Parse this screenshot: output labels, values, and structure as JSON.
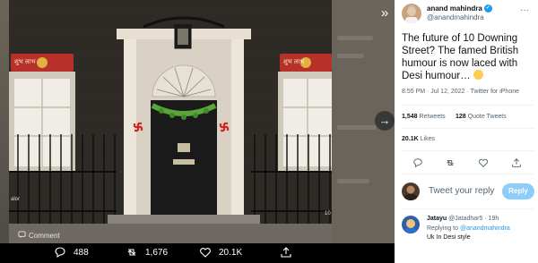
{
  "viewer": {
    "photo_texts": {
      "sign_left": "शुभ  लाभ",
      "sign_right": "शुभ  लाभ",
      "caption_left": "alor",
      "caption_right": "10"
    },
    "comment_label": "Comment",
    "actions": {
      "reply_count": "488",
      "retweet_count": "1,676",
      "like_count": "20.1K"
    },
    "bleed_text": "You a"
  },
  "tweet": {
    "author_name": "anand mahindra",
    "author_handle": "@anandmahindra",
    "text": "The future of 10 Downing Street?  The famed British humour is now laced with Desi humour…",
    "meta": "8:55 PM · Jul 12, 2022 · Twitter for iPhone",
    "retweets": "1,548",
    "retweets_label": "Retweets",
    "quotes": "128",
    "quotes_label": "Quote Tweets",
    "likes": "20.1K",
    "likes_label": "Likes"
  },
  "compose": {
    "placeholder": "Tweet your reply",
    "button": "Reply"
  },
  "replies": [
    {
      "name": "Jatayu",
      "handle": "@Jatadhar5",
      "time": "· 19h",
      "replying_prefix": "Replying to",
      "replying_to": "@anandmahindra",
      "text": "Uk In Desi style"
    }
  ],
  "colors": {
    "accent": "#1d9bf0",
    "reply_button": "#8ecdf8",
    "door": "#1b1a1a",
    "brick": "#2e2a26",
    "swastika": "#d4282a",
    "sign_bg": "#b8302a",
    "garland": "#5aa63a"
  }
}
